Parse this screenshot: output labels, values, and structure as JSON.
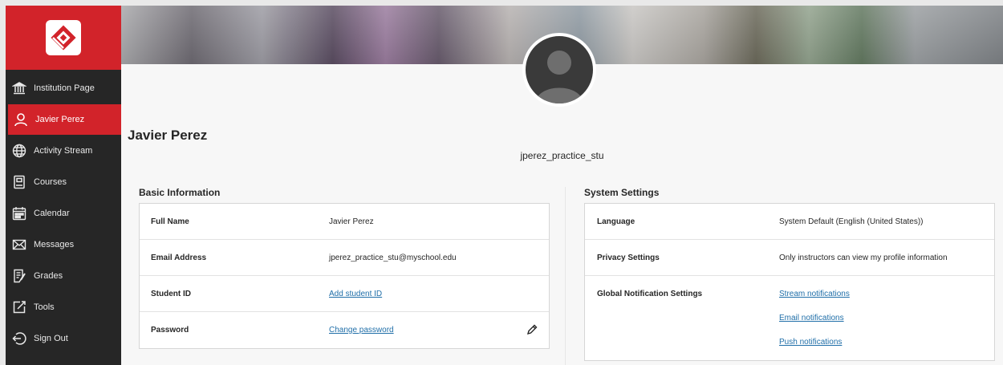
{
  "sidebar": {
    "brand_icon": "blackboard-logo-icon",
    "accent": "#d2232a",
    "items": [
      {
        "label": "Institution Page",
        "icon": "institution-icon",
        "active": false
      },
      {
        "label": "Javier Perez",
        "icon": "user-icon",
        "active": true
      },
      {
        "label": "Activity Stream",
        "icon": "globe-icon",
        "active": false
      },
      {
        "label": "Courses",
        "icon": "courses-icon",
        "active": false
      },
      {
        "label": "Calendar",
        "icon": "calendar-icon",
        "active": false
      },
      {
        "label": "Messages",
        "icon": "envelope-icon",
        "active": false
      },
      {
        "label": "Grades",
        "icon": "grades-icon",
        "active": false
      },
      {
        "label": "Tools",
        "icon": "tools-icon",
        "active": false
      },
      {
        "label": "Sign Out",
        "icon": "sign-out-icon",
        "active": false
      }
    ]
  },
  "profile": {
    "name": "Javier Perez",
    "username": "jperez_practice_stu"
  },
  "basic_info": {
    "title": "Basic Information",
    "rows": [
      {
        "label": "Full Name",
        "value": "Javier Perez"
      },
      {
        "label": "Email Address",
        "value": "jperez_practice_stu@myschool.edu"
      },
      {
        "label": "Student ID",
        "value": "Add student ID"
      },
      {
        "label": "Password",
        "value": "Change password"
      }
    ]
  },
  "system_settings": {
    "title": "System Settings",
    "rows": [
      {
        "label": "Language",
        "value": "System Default (English (United States))"
      },
      {
        "label": "Privacy Settings",
        "value": "Only instructors can view my profile information"
      },
      {
        "label": "Global Notification Settings"
      }
    ],
    "notifications": [
      "Stream notifications",
      "Email notifications",
      "Push notifications"
    ]
  },
  "colors": {
    "sidebar_bg": "#262626",
    "link": "#1f6ea8"
  }
}
